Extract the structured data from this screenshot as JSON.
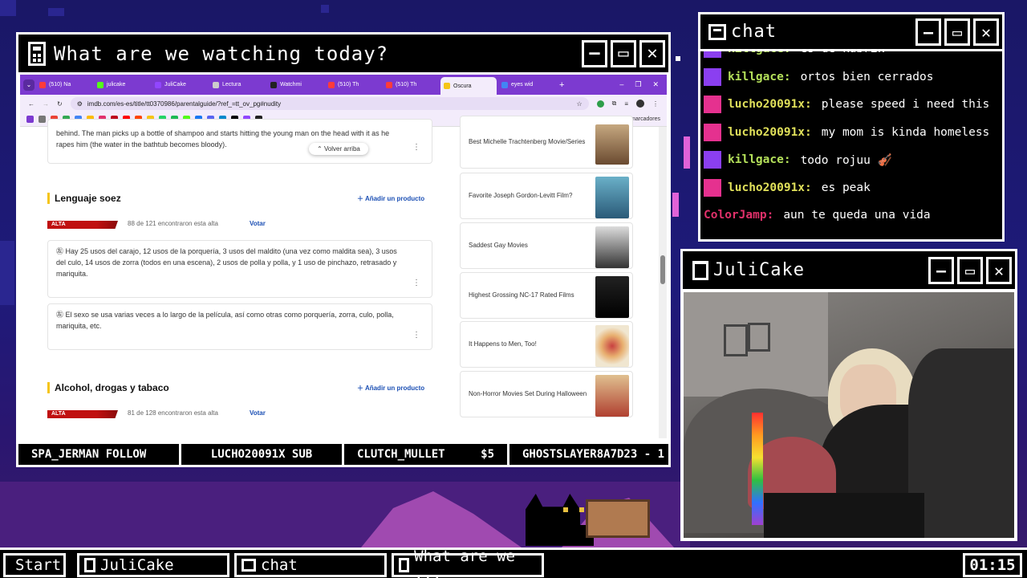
{
  "main_window": {
    "title": "What are we watching today?",
    "browser": {
      "tabs": [
        "(510) Na",
        "julicake",
        "JuliCake",
        "Lectura",
        "Watchmi",
        "(510) Th",
        "(510) Th",
        "Oscura",
        "eyes wid"
      ],
      "url": "imdb.com/es-es/title/tt0370986/parentalguide/?ref_=tt_ov_pg#nudity",
      "bookmarks_all": "Todos los marcadores",
      "top_card_text": "behind. The man picks up a bottle of shampoo and starts hitting the young man on the head with it as he rapes him (the water in the bathtub becomes bloody).",
      "volver": "Volver arriba",
      "section1": {
        "title": "Lenguaje soez",
        "add": "Añadir un producto",
        "severity": "ALTA",
        "count": "88 de 121 encontraron esta alta",
        "vote": "Votar",
        "items": [
          "Hay 25 usos del carajo, 12 usos de la porquería, 3 usos del maldito (una vez como maldita sea), 3 usos del culo, 14 usos de zorra (todos en una escena), 2 usos de polla y polla, y 1 uso de pinchazo, retrasado y mariquita.",
          "El sexo se usa varias veces a lo largo de la película, así como otras como porquería, zorra, culo, polla, mariquita, etc."
        ]
      },
      "section2": {
        "title": "Alcohol, drogas y tabaco",
        "add": "Añadir un producto",
        "severity": "ALTA",
        "count": "81 de 128 encontraron esta alta",
        "vote": "Votar"
      },
      "sidebar": [
        "Best Michelle Trachtenberg Movie/Series",
        "Favorite Joseph Gordon-Levitt Film?",
        "Saddest Gay Movies",
        "Highest Grossing NC-17 Rated Films",
        "It Happens to Men, Too!",
        "Non-Horror Movies Set During Halloween"
      ]
    }
  },
  "ticker": [
    "SPA_JERMAN FOLLOW",
    "LUCHO20091X SUB",
    "CLUTCH_MULLET",
    "$5",
    "GHOSTSLAYER8A7D23 - 1"
  ],
  "chat": {
    "title": "chat",
    "messages": [
      {
        "user": "killgace:",
        "text": "es de kubrik",
        "badge": "purple",
        "color": "#b4e05a"
      },
      {
        "user": "killgace:",
        "text": "ortos bien cerrados",
        "badge": "purple",
        "color": "#b4e05a"
      },
      {
        "user": "lucho20091x:",
        "text": "please speed i need this",
        "badge": "pink",
        "color": "#e0e05a"
      },
      {
        "user": "lucho20091x:",
        "text": "my mom is kinda homeless",
        "badge": "pink",
        "color": "#e0e05a"
      },
      {
        "user": "killgace:",
        "text": "todo rojuu 🎻",
        "badge": "purple",
        "color": "#b4e05a"
      },
      {
        "user": "lucho20091x:",
        "text": "es peak",
        "badge": "pink",
        "color": "#e0e05a"
      },
      {
        "user": "ColorJamp:",
        "text": "aun te queda una vida",
        "badge": "",
        "color": "#e0306a"
      }
    ]
  },
  "cam": {
    "title": "JuliCake"
  },
  "taskbar": {
    "start": "Start",
    "items": [
      "JuliCake",
      "chat",
      "What are we ..."
    ],
    "clock": "01:15"
  }
}
